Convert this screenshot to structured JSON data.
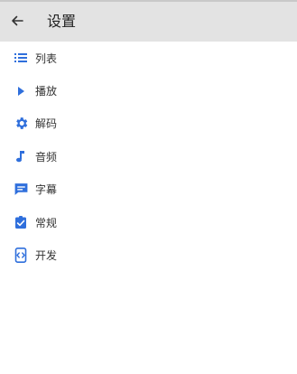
{
  "header": {
    "title": "设置",
    "back_icon": "arrow-left-icon"
  },
  "accent_color": "#2f6fdc",
  "menu": {
    "items": [
      {
        "label": "列表",
        "icon": "list-icon"
      },
      {
        "label": "播放",
        "icon": "play-icon"
      },
      {
        "label": "解码",
        "icon": "gear-icon"
      },
      {
        "label": "音频",
        "icon": "music-note-icon"
      },
      {
        "label": "字幕",
        "icon": "subtitle-icon"
      },
      {
        "label": "常规",
        "icon": "clipboard-check-icon"
      },
      {
        "label": "开发",
        "icon": "developer-mode-icon"
      }
    ]
  }
}
